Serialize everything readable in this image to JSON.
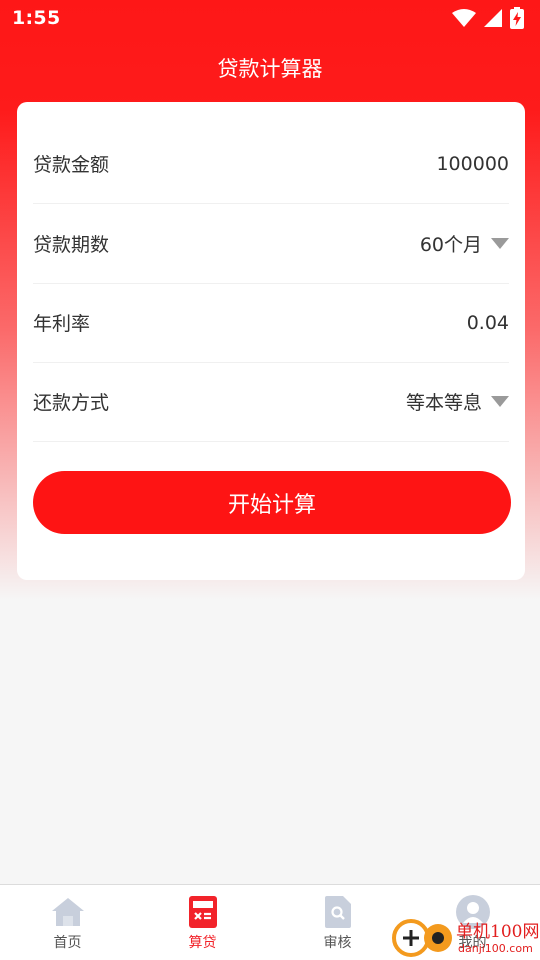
{
  "status_bar": {
    "time": "1:55"
  },
  "header": {
    "title": "贷款计算器"
  },
  "form": {
    "rows": [
      {
        "label": "贷款金额",
        "value": "100000"
      },
      {
        "label": "贷款期数",
        "value": "60个月"
      },
      {
        "label": "年利率",
        "value": "0.04"
      },
      {
        "label": "还款方式",
        "value": "等本等息"
      }
    ],
    "submit_label": "开始计算"
  },
  "bottom_nav": {
    "items": [
      {
        "label": "首页"
      },
      {
        "label": "算贷"
      },
      {
        "label": "审核"
      },
      {
        "label": "我的"
      }
    ],
    "active_color": "#f2232a",
    "inactive_icon_color": "#c8cfdc"
  },
  "watermark": {
    "text": "单机100网",
    "url": "danji100.com"
  },
  "colors": {
    "primary": "#fe1414"
  }
}
